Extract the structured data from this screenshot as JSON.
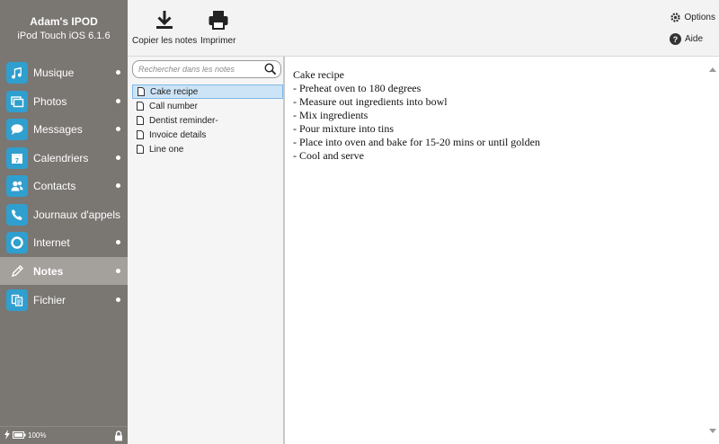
{
  "device": {
    "name": "Adam's IPOD",
    "model": "iPod Touch iOS 6.1.6"
  },
  "sidebar": {
    "items": [
      {
        "label": "Musique",
        "icon": "music-icon",
        "dot": true
      },
      {
        "label": "Photos",
        "icon": "photo-icon",
        "dot": true
      },
      {
        "label": "Messages",
        "icon": "message-icon",
        "dot": true
      },
      {
        "label": "Calendriers",
        "icon": "calendar-icon",
        "dot": true
      },
      {
        "label": "Contacts",
        "icon": "contacts-icon",
        "dot": true
      },
      {
        "label": "Journaux d'appels",
        "icon": "phone-icon",
        "dot": false
      },
      {
        "label": "Internet",
        "icon": "internet-icon",
        "dot": true
      },
      {
        "label": "Notes",
        "icon": "pencil-icon",
        "dot": true,
        "active": true
      },
      {
        "label": "Fichier",
        "icon": "file-icon",
        "dot": true
      }
    ]
  },
  "status": {
    "battery": "100%"
  },
  "toolbar": {
    "copy_label": "Copier les notes",
    "print_label": "Imprimer",
    "options_label": "Options",
    "help_label": "Aide"
  },
  "search": {
    "placeholder": "Rechercher dans les notes"
  },
  "notes": [
    {
      "title": "Cake recipe",
      "selected": true
    },
    {
      "title": "Call number"
    },
    {
      "title": "Dentist reminder-"
    },
    {
      "title": "Invoice details"
    },
    {
      "title": "Line one"
    }
  ],
  "note_content": {
    "lines": [
      "Cake recipe",
      "- Preheat oven to 180 degrees",
      "- Measure out ingredients into bowl",
      "- Mix ingredients",
      "- Pour mixture into tins",
      "- Place into oven and bake for 15-20 mins or until golden",
      "- Cool and serve"
    ]
  },
  "colors": {
    "sidebar": "#7a7672",
    "sidebar_active": "#a4a09c",
    "icon_bg": "#2f9fcf",
    "selection": "#cde4f7"
  }
}
